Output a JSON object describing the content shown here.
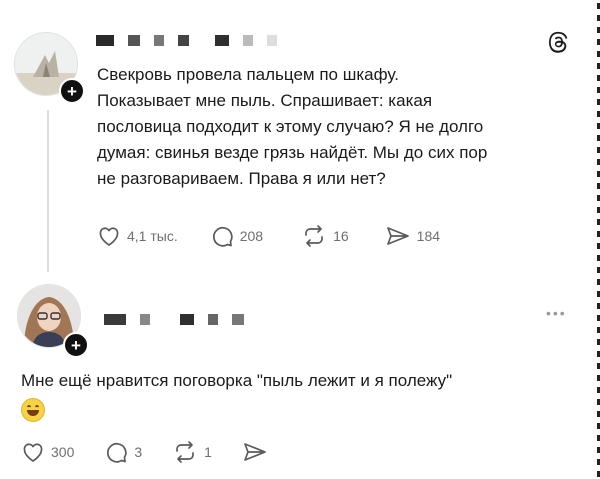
{
  "post": {
    "text": "Свекровь провела пальцем по шкафу.\nПоказывает мне пыль. Спрашивает: какая\nпословица подходит к этому случаю? Я не долго\nдумая: свинья везде грязь найдёт. Мы до сих пор\nне разговариваем. Права я или нет?",
    "likes": "4,1 тыс.",
    "comments": "208",
    "reposts": "16",
    "shares": "184"
  },
  "reply": {
    "text": "Мне ещё нравится поговорка \"пыль лежит и я полежу\"",
    "emoji": "grinning-face",
    "likes": "300",
    "comments": "3",
    "reposts": "1"
  },
  "icons": {
    "logo": "threads-logo",
    "follow": "plus-icon",
    "like": "heart-icon",
    "comment": "comment-icon",
    "repost": "repost-icon",
    "share": "send-icon",
    "more": "more-icon"
  },
  "colors": {
    "text": "#1b1b1b",
    "muted": "#6f6f6f",
    "thread_line": "#dcdcdc",
    "badge": "#111111"
  }
}
